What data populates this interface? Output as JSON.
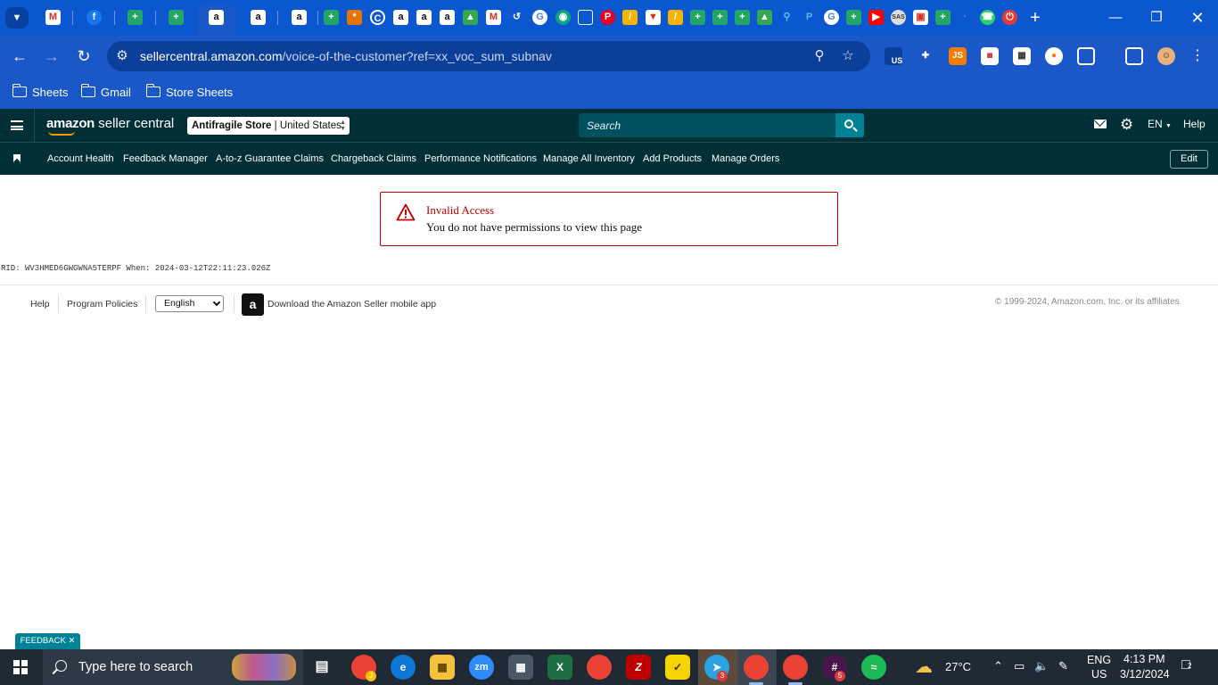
{
  "browser": {
    "url_host": "sellercentral.amazon.com",
    "url_path": "/voice-of-the-customer?ref=xx_voc_sum_subnav",
    "bookmarks": [
      "Sheets",
      "Gmail",
      "Store Sheets"
    ],
    "extension_badge": "US",
    "extension_js_label": "JS"
  },
  "header": {
    "logo_brand": "amazon",
    "logo_product": " seller central",
    "store_name": "Antifragile Store",
    "store_region": " | United States",
    "search_placeholder": "Search",
    "language": "EN",
    "help": "Help"
  },
  "nav": {
    "links": [
      "Account Health",
      "Feedback Manager",
      "A-to-z Guarantee Claims",
      "Chargeback Claims",
      "Performance Notifications",
      "Manage All Inventory",
      "Add Products",
      "Manage Orders"
    ],
    "edit_label": "Edit"
  },
  "alert": {
    "title": "Invalid Access",
    "message": "You do not have permissions to view this page"
  },
  "rid_line": "RID: WV3HMED6GWGWNA5TERPF When: 2024-03-12T22:11:23.026Z",
  "footer": {
    "help": "Help",
    "program_policies": "Program Policies",
    "language_selected": "English",
    "app_link": "Download the Amazon Seller mobile app",
    "copyright": "© 1999-2024, Amazon.com, Inc. or its affiliates"
  },
  "feedback_tab": "FEEDBACK ✕",
  "taskbar": {
    "search_placeholder": "Type here to search",
    "weather": "27°C",
    "lang_line1": "ENG",
    "lang_line2": "US",
    "time": "4:13 PM",
    "date": "3/12/2024",
    "notification_count": "2",
    "zoom_label": "zm",
    "badge_chrome": "J",
    "badge_telegram": "3",
    "badge_slack": "5"
  }
}
